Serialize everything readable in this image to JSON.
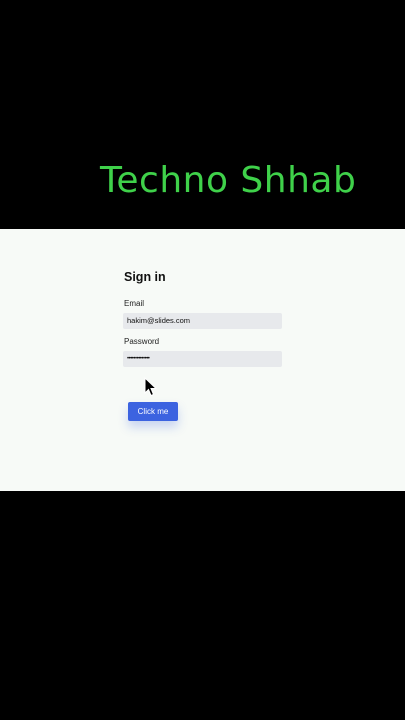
{
  "banner": {
    "title": "Techno Shhab"
  },
  "form": {
    "title": "Sign in",
    "email_label": "Email",
    "email_value": "hakim@slides.com",
    "password_label": "Password",
    "password_value": "••••••••••••••",
    "button_label": "Click me"
  },
  "colors": {
    "banner_text": "#3fd14a",
    "button": "#3c63e0",
    "panel_bg": "#f7faf7"
  },
  "icons": {
    "pointer": "arrow-cursor-icon"
  }
}
